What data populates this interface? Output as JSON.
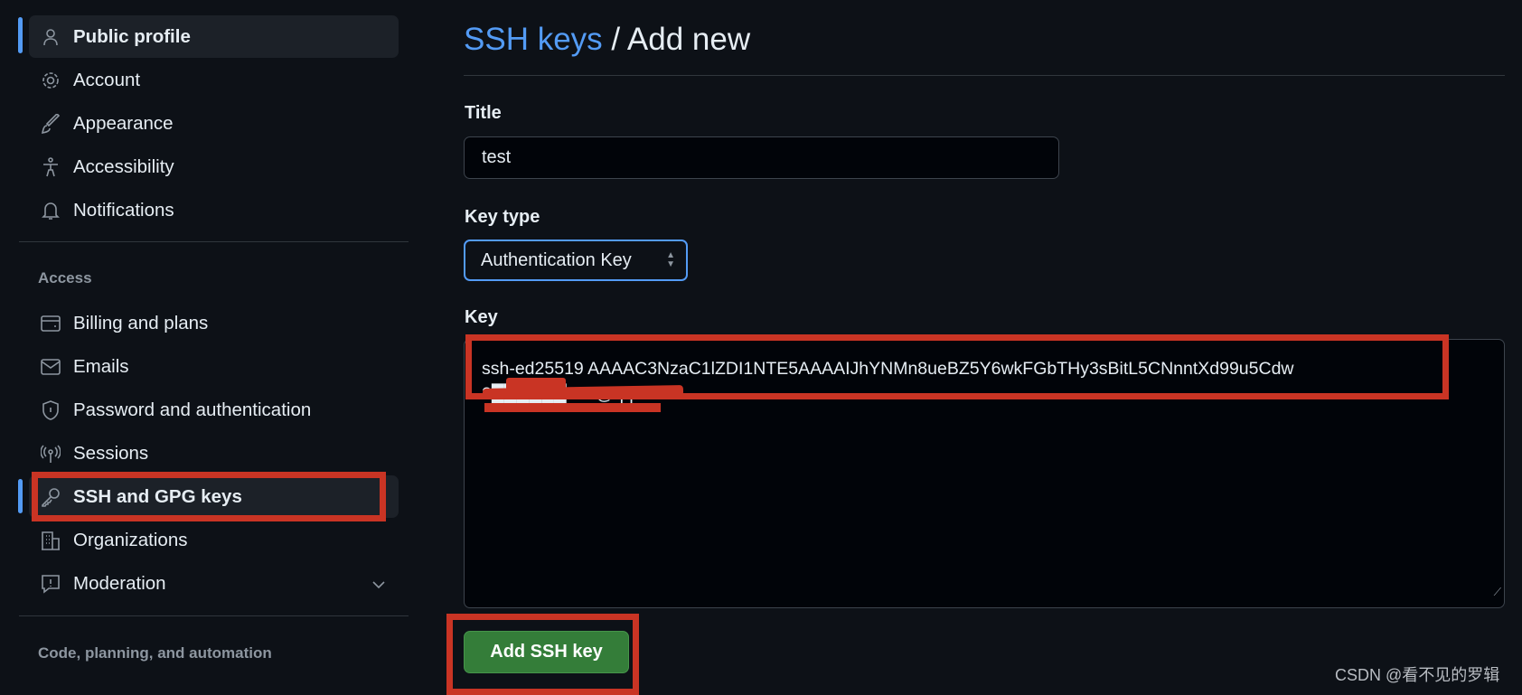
{
  "sidebar": {
    "items": [
      {
        "label": "Public profile",
        "icon": "person-icon",
        "active": true
      },
      {
        "label": "Account",
        "icon": "gear-icon"
      },
      {
        "label": "Appearance",
        "icon": "paintbrush-icon"
      },
      {
        "label": "Accessibility",
        "icon": "accessibility-icon"
      },
      {
        "label": "Notifications",
        "icon": "bell-icon"
      }
    ],
    "access_heading": "Access",
    "access_items": [
      {
        "label": "Billing and plans",
        "icon": "credit-card-icon"
      },
      {
        "label": "Emails",
        "icon": "mail-icon"
      },
      {
        "label": "Password and authentication",
        "icon": "shield-icon"
      },
      {
        "label": "Sessions",
        "icon": "broadcast-icon"
      },
      {
        "label": "SSH and GPG keys",
        "icon": "key-icon",
        "active": true
      },
      {
        "label": "Organizations",
        "icon": "organization-icon"
      },
      {
        "label": "Moderation",
        "icon": "report-icon"
      }
    ],
    "code_heading": "Code, planning, and automation"
  },
  "header": {
    "breadcrumb_link": "SSH keys",
    "separator": "/",
    "current": "Add new"
  },
  "form": {
    "title_label": "Title",
    "title_value": "test",
    "key_type_label": "Key type",
    "key_type_value": "Authentication Key",
    "key_label": "Key",
    "key_value_line1": "ssh-ed25519 AAAAC3NzaC1lZDI1NTE5AAAAIJhYNMn8ueBZ5Y6wkFGbTHy3sBitL5CNnntXd99u5Cdw",
    "key_value_line2": "2██████518@qq.com",
    "submit_label": "Add SSH key"
  },
  "watermark": "CSDN @看不见的罗辑",
  "colors": {
    "accent": "#539bf5",
    "annotation": "#c93424",
    "primary_button": "#347d39"
  }
}
